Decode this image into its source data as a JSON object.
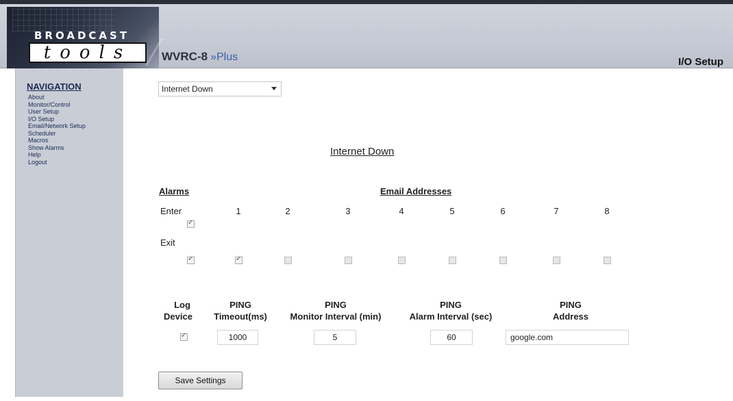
{
  "header": {
    "logo_top": "BROADCAST",
    "logo_bottom": "tools",
    "product_name": "WVRC-8",
    "product_arrow": "»",
    "product_sub": "Plus",
    "page_title": "I/O Setup"
  },
  "navigation": {
    "title": "NAVIGATION",
    "items": [
      {
        "label": "About"
      },
      {
        "label": "Monitor/Control"
      },
      {
        "label": "User Setup"
      },
      {
        "label": "I/O Setup"
      },
      {
        "label": "Email/Network Setup"
      },
      {
        "label": "Scheduler"
      },
      {
        "label": "Macros"
      },
      {
        "label": "Show Alarms"
      },
      {
        "label": "Help"
      },
      {
        "label": "Logout"
      }
    ]
  },
  "main": {
    "select_value": "Internet Down",
    "section_title": "Internet Down",
    "alarms_label": "Alarms",
    "email_label": "Email Addresses",
    "enter_label": "Enter",
    "exit_label": "Exit",
    "email_columns": [
      "1",
      "2",
      "3",
      "4",
      "5",
      "6",
      "7",
      "8"
    ],
    "enter_checked": true,
    "exit_checked": true,
    "email_checked": [
      true,
      false,
      false,
      false,
      false,
      false,
      false,
      false
    ],
    "ping": {
      "log_device_label_1": "Log",
      "log_device_label_2": "Device",
      "timeout_label_1": "PING",
      "timeout_label_2": "Timeout(ms)",
      "monitor_label_1": "PING",
      "monitor_label_2": "Monitor Interval (min)",
      "alarm_label_1": "PING",
      "alarm_label_2": "Alarm Interval (sec)",
      "address_label_1": "PING",
      "address_label_2": "Address",
      "log_device_checked": true,
      "timeout_value": "1000",
      "monitor_value": "5",
      "alarm_value": "60",
      "address_value": "google.com"
    },
    "save_label": "Save Settings"
  }
}
